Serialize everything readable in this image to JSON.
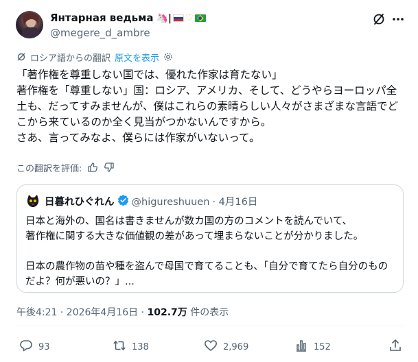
{
  "author": {
    "name": "Янтарная ведьма",
    "name_suffix": "🦄|",
    "handle": "@megere_d_ambre"
  },
  "icons": {
    "grok": "grok-slash-circle-icon",
    "more": "more-dots-icon"
  },
  "translation": {
    "notice": "ロシア語からの翻訳",
    "show_original": "原文を表示",
    "rate_label": "この翻訳を評価:"
  },
  "post": {
    "text": "「著作権を尊重しない国では、優れた作家は育たない」\n著作権を「尊重しない」国：ロシア、アメリカ、そして、どうやらヨーロッパ全土も、だってすみませんが、僕はこれらの素晴らしい人々がさまざまな言語でどこから来ているのか全く見当がつかないんですから。\nさあ、言ってみなよ、僕らには作家がいないって。"
  },
  "quote": {
    "name": "日暮れひぐれん",
    "handle": "@higureshuuen",
    "date": "· 4月16日",
    "text": "日本と海外の、国名は書きませんが数カ国の方のコメントを読んでいて、\n著作権に関する大きな価値観の差があって埋まらないことが分かりました。\n\n日本の農作物の苗や種を盗んで母国で育てることも、「自分で育てたら自分のものだよ？何が悪いの？」..."
  },
  "meta": {
    "time": "午後4:21 · 2026年4月16日 · ",
    "views": "102.7万",
    "views_suffix": " 件の表示"
  },
  "actions": {
    "replies": "93",
    "reposts": "138",
    "likes": "2,969",
    "bookmarks": "152"
  },
  "colors": {
    "accent": "#1d9bf0",
    "secondary_text": "#536471",
    "verified": "#1d9bf0"
  }
}
